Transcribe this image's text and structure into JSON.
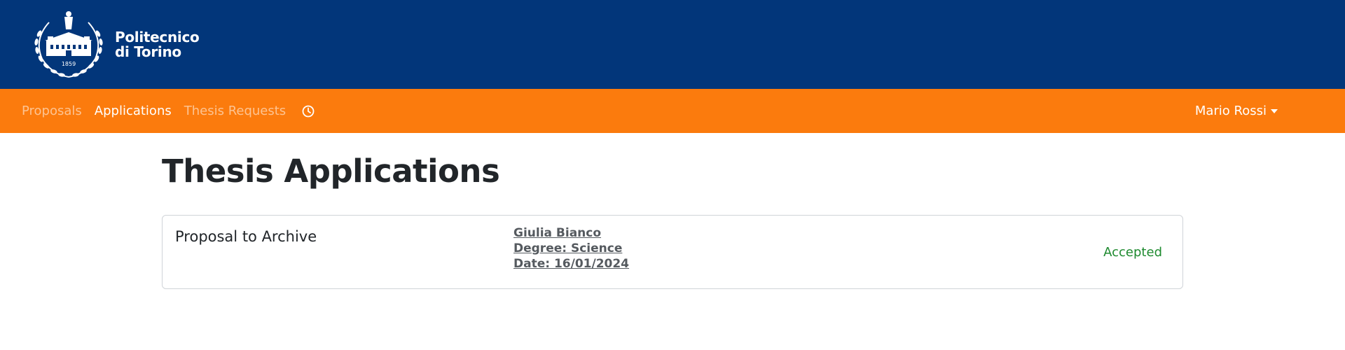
{
  "header": {
    "brand_line1": "Politecnico",
    "brand_line2": "di Torino",
    "seal_year": "1859",
    "seal_icon": "politecnico-seal"
  },
  "nav": {
    "items": [
      {
        "label": "Proposals",
        "active": false
      },
      {
        "label": "Applications",
        "active": true
      },
      {
        "label": "Thesis Requests",
        "active": false
      }
    ],
    "history_icon": "clock-icon",
    "user_name": "Mario Rossi"
  },
  "main": {
    "title": "Thesis Applications",
    "applications": [
      {
        "proposal_title": "Proposal to Archive",
        "student_name": "Giulia Bianco",
        "degree": "Degree: Science",
        "date": "Date: 16/01/2024",
        "status": "Accepted"
      }
    ]
  },
  "colors": {
    "header_bg": "#02367a",
    "navbar_bg": "#fb7b0d",
    "status_accepted": "#1e8a2f"
  }
}
